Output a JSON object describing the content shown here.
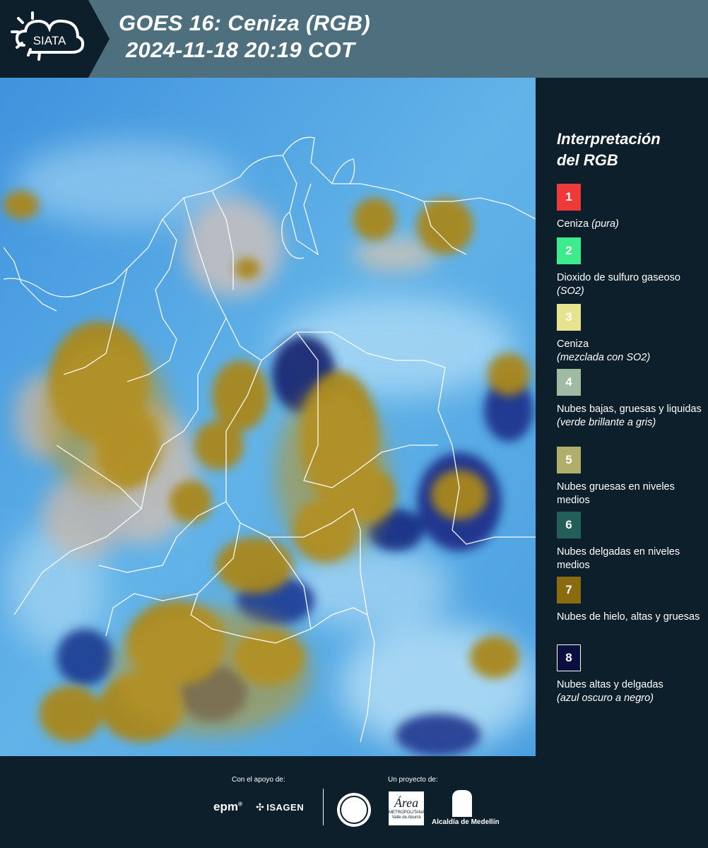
{
  "header": {
    "logo_text": "SIATA",
    "title_line1": "GOES 16: Ceniza (RGB)",
    "title_line2": "2024-11-18 20:19 COT"
  },
  "legend": {
    "title_line1": "Interpretación",
    "title_line2": "del RGB",
    "items": [
      {
        "number": "1",
        "color": "#ef3a3a",
        "label": "Ceniza",
        "inline_note": "(pura)",
        "note": ""
      },
      {
        "number": "2",
        "color": "#3dea8c",
        "label": "Dioxido de sulfuro gaseoso",
        "inline_note": "(SO2)",
        "note": ""
      },
      {
        "number": "3",
        "color": "#e6e38e",
        "label": "Ceniza",
        "inline_note": "",
        "note": "(mezclada con SO2)"
      },
      {
        "number": "4",
        "color": "#9fbba1",
        "label": "Nubes bajas, gruesas y liquidas",
        "inline_note": "",
        "note": "(verde brillante a gris)"
      },
      {
        "number": "5",
        "color": "#b1ad6a",
        "label": "Nubes gruesas en niveles medios",
        "inline_note": "",
        "note": ""
      },
      {
        "number": "6",
        "color": "#235f58",
        "label": "Nubes delgadas en niveles medios",
        "inline_note": "",
        "note": ""
      },
      {
        "number": "7",
        "color": "#8a6b0f",
        "label": "Nubes de hielo, altas y gruesas",
        "inline_note": "",
        "note": ""
      },
      {
        "number": "8",
        "color": "#0b0f40",
        "label": "Nubes altas y delgadas",
        "inline_note": "",
        "note": "(azul oscuro a negro)"
      }
    ]
  },
  "footer": {
    "support_label": "Con el apoyo de:",
    "project_label": "Un proyecto de:",
    "sponsor_epm": "epm",
    "sponsor_isagen": "ISAGEN",
    "area_logo_text": "Área",
    "area_logo_sub": "METROPOLITANA",
    "area_logo_sub2": "Valle de Aburrá",
    "alcaldia": "Alcaldía de Medellín"
  }
}
